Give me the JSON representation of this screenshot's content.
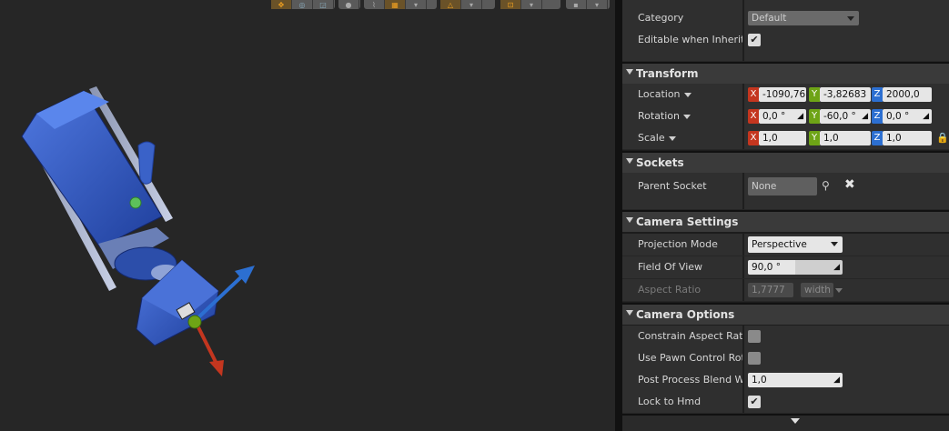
{
  "viewport": {
    "toolbar_icons": [
      "move-icon",
      "rotate-icon",
      "scale-icon",
      "world-icon",
      "surface-snap-icon",
      "grid-snap-icon",
      "angle-snap-icon",
      "scale-snap-icon",
      "camera-speed-icon",
      "maximize-icon"
    ]
  },
  "details": {
    "top_rows": [
      {
        "label": "Category",
        "value": "Default"
      },
      {
        "label": "Editable when Inherited",
        "checked": true
      }
    ],
    "transform": {
      "title": "Transform",
      "location": {
        "label": "Location",
        "x": "-1090,76",
        "y": "-3,82683",
        "z": "2000,0"
      },
      "rotation": {
        "label": "Rotation",
        "x": "0,0 °",
        "y": "-60,0 °",
        "z": "0,0 °"
      },
      "scale": {
        "label": "Scale",
        "x": "1,0",
        "y": "1,0",
        "z": "1,0"
      },
      "axis_x": "X",
      "axis_y": "Y",
      "axis_z": "Z"
    },
    "sockets": {
      "title": "Sockets",
      "parent_socket": {
        "label": "Parent Socket",
        "value": "None"
      }
    },
    "camera_settings": {
      "title": "Camera Settings",
      "projection_mode": {
        "label": "Projection Mode",
        "value": "Perspective"
      },
      "field_of_view": {
        "label": "Field Of View",
        "value": "90,0 °"
      },
      "aspect_ratio": {
        "label": "Aspect Ratio",
        "value": "1,7777",
        "dim": "width"
      }
    },
    "camera_options": {
      "title": "Camera Options",
      "constrain_aspect_ratio": {
        "label": "Constrain Aspect Ratio",
        "checked": false
      },
      "use_pawn_control_rotation": {
        "label": "Use Pawn Control Rotation",
        "checked": false
      },
      "post_process_blend_weight": {
        "label": "Post Process Blend Weight",
        "value": "1,0"
      },
      "lock_to_hmd": {
        "label": "Lock to Hmd",
        "checked": true
      }
    }
  },
  "colors": {
    "axis_x": "#c4361f",
    "axis_y": "#6ea416",
    "axis_z": "#2c6fd1",
    "camera_body": "#3a62c8",
    "toolbar_accent": "#f0a020"
  }
}
